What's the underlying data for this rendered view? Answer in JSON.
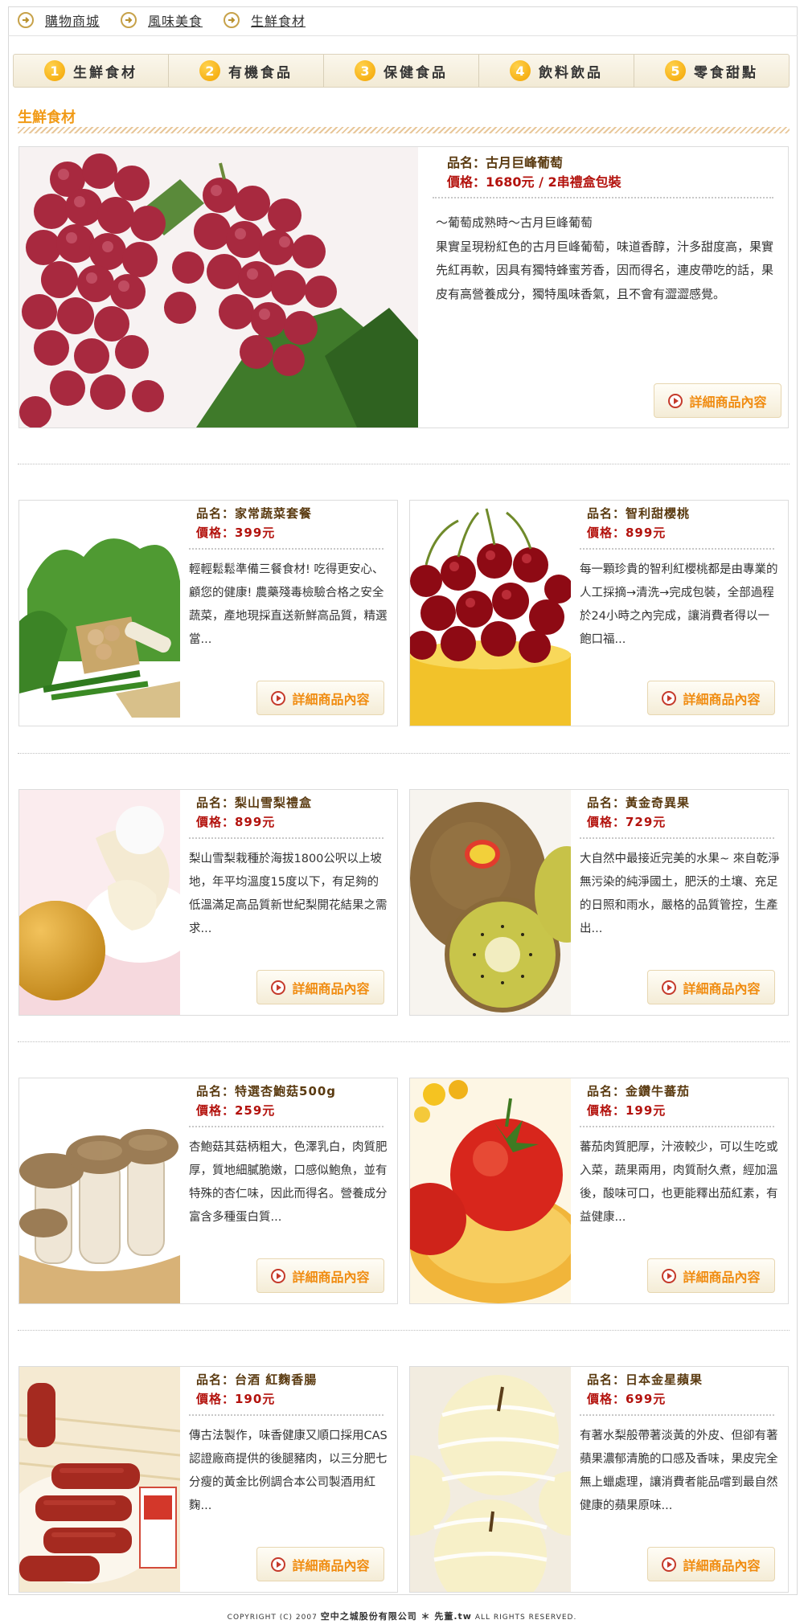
{
  "breadcrumb": [
    "購物商城",
    "風味美食",
    "生鮮食材"
  ],
  "nav": [
    {
      "num": "1",
      "label": "生鮮食材"
    },
    {
      "num": "2",
      "label": "有機食品"
    },
    {
      "num": "3",
      "label": "保健食品"
    },
    {
      "num": "4",
      "label": "飲料飲品"
    },
    {
      "num": "5",
      "label": "零食甜點"
    }
  ],
  "section_title": "生鮮食材",
  "featured": {
    "name_label": "品名：古月巨峰葡萄",
    "price_label": "價格：1680元 / 2串禮盒包裝",
    "tagline": "～葡萄成熟時～古月巨峰葡萄",
    "desc": "果實呈現粉紅色的古月巨峰葡萄，味道香醇，汁多甜度高，果實先紅再軟，因具有獨特蜂蜜芳香，因而得名，連皮帶吃的話，果皮有高營養成分，獨特風味香氣，且不會有澀澀感覺。",
    "button": "詳細商品內容"
  },
  "products": [
    {
      "name": "品名：家常蔬菜套餐",
      "price": "價格：399元",
      "desc": "輕輕鬆鬆準備三餐食材! 吃得更安心、顧您的健康! 農藥殘毒檢驗合格之安全蔬菜，產地現採直送新鮮高品質，精選當...",
      "button": "詳細商品內容"
    },
    {
      "name": "品名：智利甜櫻桃",
      "price": "價格：899元",
      "desc": "每一顆珍貴的智利紅櫻桃都是由專業的人工採摘→清洗→完成包裝，全部過程於24小時之內完成，讓消費者得以一飽口福...",
      "button": "詳細商品內容"
    },
    {
      "name": "品名：梨山雪梨禮盒",
      "price": "價格：899元",
      "desc": "梨山雪梨栽種於海拔1800公呎以上坡地，年平均溫度15度以下，有足夠的低溫滿足高品質新世紀梨開花結果之需求...",
      "button": "詳細商品內容"
    },
    {
      "name": "品名：黃金奇異果",
      "price": "價格：729元",
      "desc": "大自然中最接近完美的水果~ 來自乾淨無污染的純淨國土，肥沃的土壤、充足的日照和雨水，嚴格的品質管控，生產出...",
      "button": "詳細商品內容"
    },
    {
      "name": "品名：特選杏鮑菇500g",
      "price": "價格：259元",
      "desc": "杏鮑菇其菇柄粗大，色澤乳白，肉質肥厚，質地細膩脆嫩，口感似鮑魚，並有特殊的杏仁味，因此而得名。營養成分富含多種蛋白質...",
      "button": "詳細商品內容"
    },
    {
      "name": "品名：金鑽牛蕃茄",
      "price": "價格：199元",
      "desc": "蕃茄肉質肥厚，汁液較少，可以生吃或入菜，蔬果兩用，肉質耐久煮，經加溫後，酸味可口，也更能釋出茄紅素，有益健康...",
      "button": "詳細商品內容"
    },
    {
      "name": "品名：台酒 紅麴香腸",
      "price": "價格：190元",
      "desc": "傳古法製作，味香健康又順口採用CAS認證廠商提供的後腿豬肉，以三分肥七分瘦的黃金比例調合本公司製酒用紅麴...",
      "button": "詳細商品內容"
    },
    {
      "name": "品名：日本金星蘋果",
      "price": "價格：699元",
      "desc": "有著水梨般帶著淡黃的外皮、但卻有著蘋果濃郁清脆的口感及香味，果皮完全無上蠟處理，讓消費者能品嚐到最自然健康的蘋果原味...",
      "button": "詳細商品內容"
    }
  ],
  "footer": {
    "prefix": "COPYRIGHT (C) 2007 ",
    "company": "空中之城股份有限公司 ＊ 先董.tw",
    "suffix": " ALL RIGHTS RESERVED."
  }
}
